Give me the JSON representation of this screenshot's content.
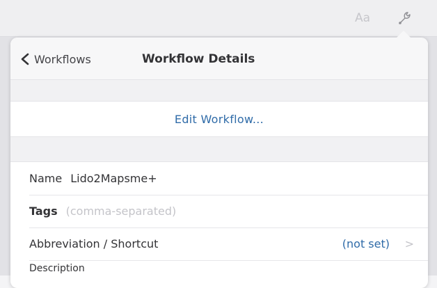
{
  "toolbar": {
    "font_button_label": "Aa",
    "wrench_icon": "wrench-icon"
  },
  "nav": {
    "back_label": "Workflows",
    "back_icon": "chevron-left-icon",
    "title": "Workflow Details"
  },
  "actions": {
    "edit_workflow_label": "Edit Workflow..."
  },
  "form": {
    "name_label": "Name",
    "name_value": "Lido2Mapsme+",
    "tags_label": "Tags",
    "tags_placeholder": "(comma-separated)",
    "abbreviation_label": "Abbreviation / Shortcut",
    "abbreviation_value": "(not set)",
    "abbreviation_chevron": ">",
    "description_label": "Description"
  },
  "colors": {
    "accent": "#2f6ba8",
    "background": "#f4f4f6",
    "panel": "#ffffff"
  }
}
